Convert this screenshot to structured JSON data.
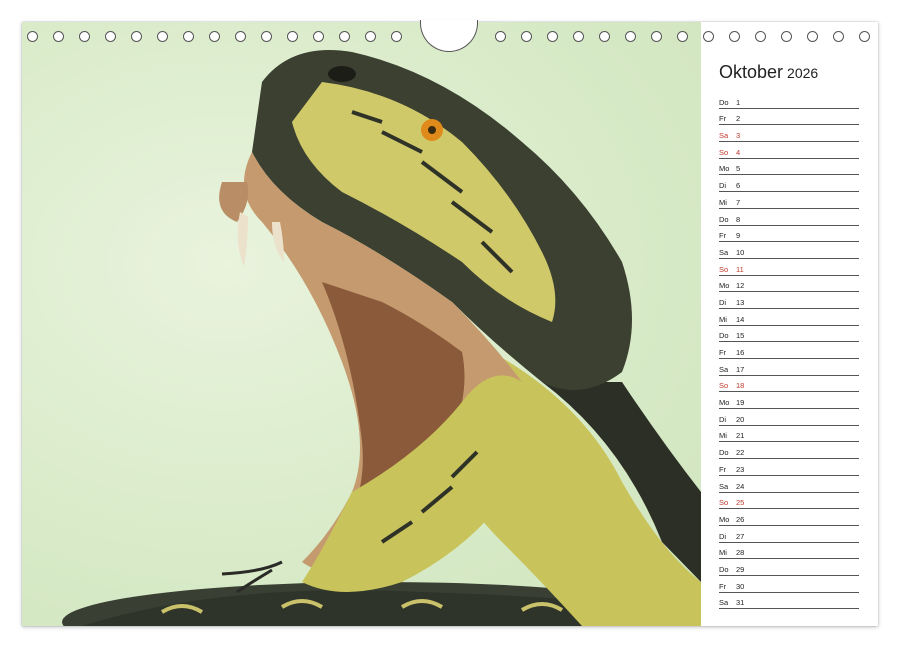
{
  "calendar": {
    "month": "Oktober",
    "year": "2026",
    "days": [
      {
        "wd": "Do",
        "d": "1",
        "red": false
      },
      {
        "wd": "Fr",
        "d": "2",
        "red": false
      },
      {
        "wd": "Sa",
        "d": "3",
        "red": true
      },
      {
        "wd": "So",
        "d": "4",
        "red": true
      },
      {
        "wd": "Mo",
        "d": "5",
        "red": false
      },
      {
        "wd": "Di",
        "d": "6",
        "red": false
      },
      {
        "wd": "Mi",
        "d": "7",
        "red": false
      },
      {
        "wd": "Do",
        "d": "8",
        "red": false
      },
      {
        "wd": "Fr",
        "d": "9",
        "red": false
      },
      {
        "wd": "Sa",
        "d": "10",
        "red": false
      },
      {
        "wd": "So",
        "d": "11",
        "red": true
      },
      {
        "wd": "Mo",
        "d": "12",
        "red": false
      },
      {
        "wd": "Di",
        "d": "13",
        "red": false
      },
      {
        "wd": "Mi",
        "d": "14",
        "red": false
      },
      {
        "wd": "Do",
        "d": "15",
        "red": false
      },
      {
        "wd": "Fr",
        "d": "16",
        "red": false
      },
      {
        "wd": "Sa",
        "d": "17",
        "red": false
      },
      {
        "wd": "So",
        "d": "18",
        "red": true
      },
      {
        "wd": "Mo",
        "d": "19",
        "red": false
      },
      {
        "wd": "Di",
        "d": "20",
        "red": false
      },
      {
        "wd": "Mi",
        "d": "21",
        "red": false
      },
      {
        "wd": "Do",
        "d": "22",
        "red": false
      },
      {
        "wd": "Fr",
        "d": "23",
        "red": false
      },
      {
        "wd": "Sa",
        "d": "24",
        "red": false
      },
      {
        "wd": "So",
        "d": "25",
        "red": true
      },
      {
        "wd": "Mo",
        "d": "26",
        "red": false
      },
      {
        "wd": "Di",
        "d": "27",
        "red": false
      },
      {
        "wd": "Mi",
        "d": "28",
        "red": false
      },
      {
        "wd": "Do",
        "d": "29",
        "red": false
      },
      {
        "wd": "Fr",
        "d": "30",
        "red": false
      },
      {
        "wd": "Sa",
        "d": "31",
        "red": false
      }
    ]
  },
  "colors": {
    "sunday_red": "#c0392b",
    "photo_background": "#d9ebc9"
  }
}
